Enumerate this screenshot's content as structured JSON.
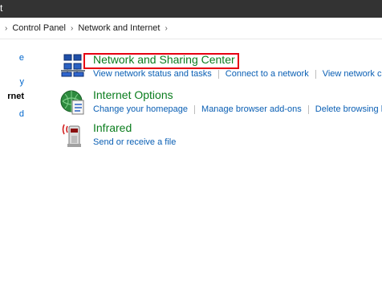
{
  "window": {
    "title": "t"
  },
  "address": {
    "breadcrumbs": [
      "Control Panel",
      "Network and Internet"
    ]
  },
  "sidebar": {
    "items": [
      {
        "label": "e"
      },
      {
        "label": "y"
      },
      {
        "label": "rnet"
      },
      {
        "label": "d"
      }
    ]
  },
  "categories": [
    {
      "title": "Network and Sharing Center",
      "icon": "network-icon",
      "links": [
        "View network status and tasks",
        "Connect to a network",
        "View network con"
      ]
    },
    {
      "title": "Internet Options",
      "icon": "internet-options-icon",
      "links": [
        "Change your homepage",
        "Manage browser add-ons",
        "Delete browsing hi"
      ]
    },
    {
      "title": "Infrared",
      "icon": "infrared-icon",
      "links": [
        "Send or receive a file"
      ]
    }
  ],
  "colors": {
    "title_bar": "#333333",
    "category_title": "#0b7d1e",
    "link": "#0a5fb4",
    "highlight": "#e60012"
  }
}
